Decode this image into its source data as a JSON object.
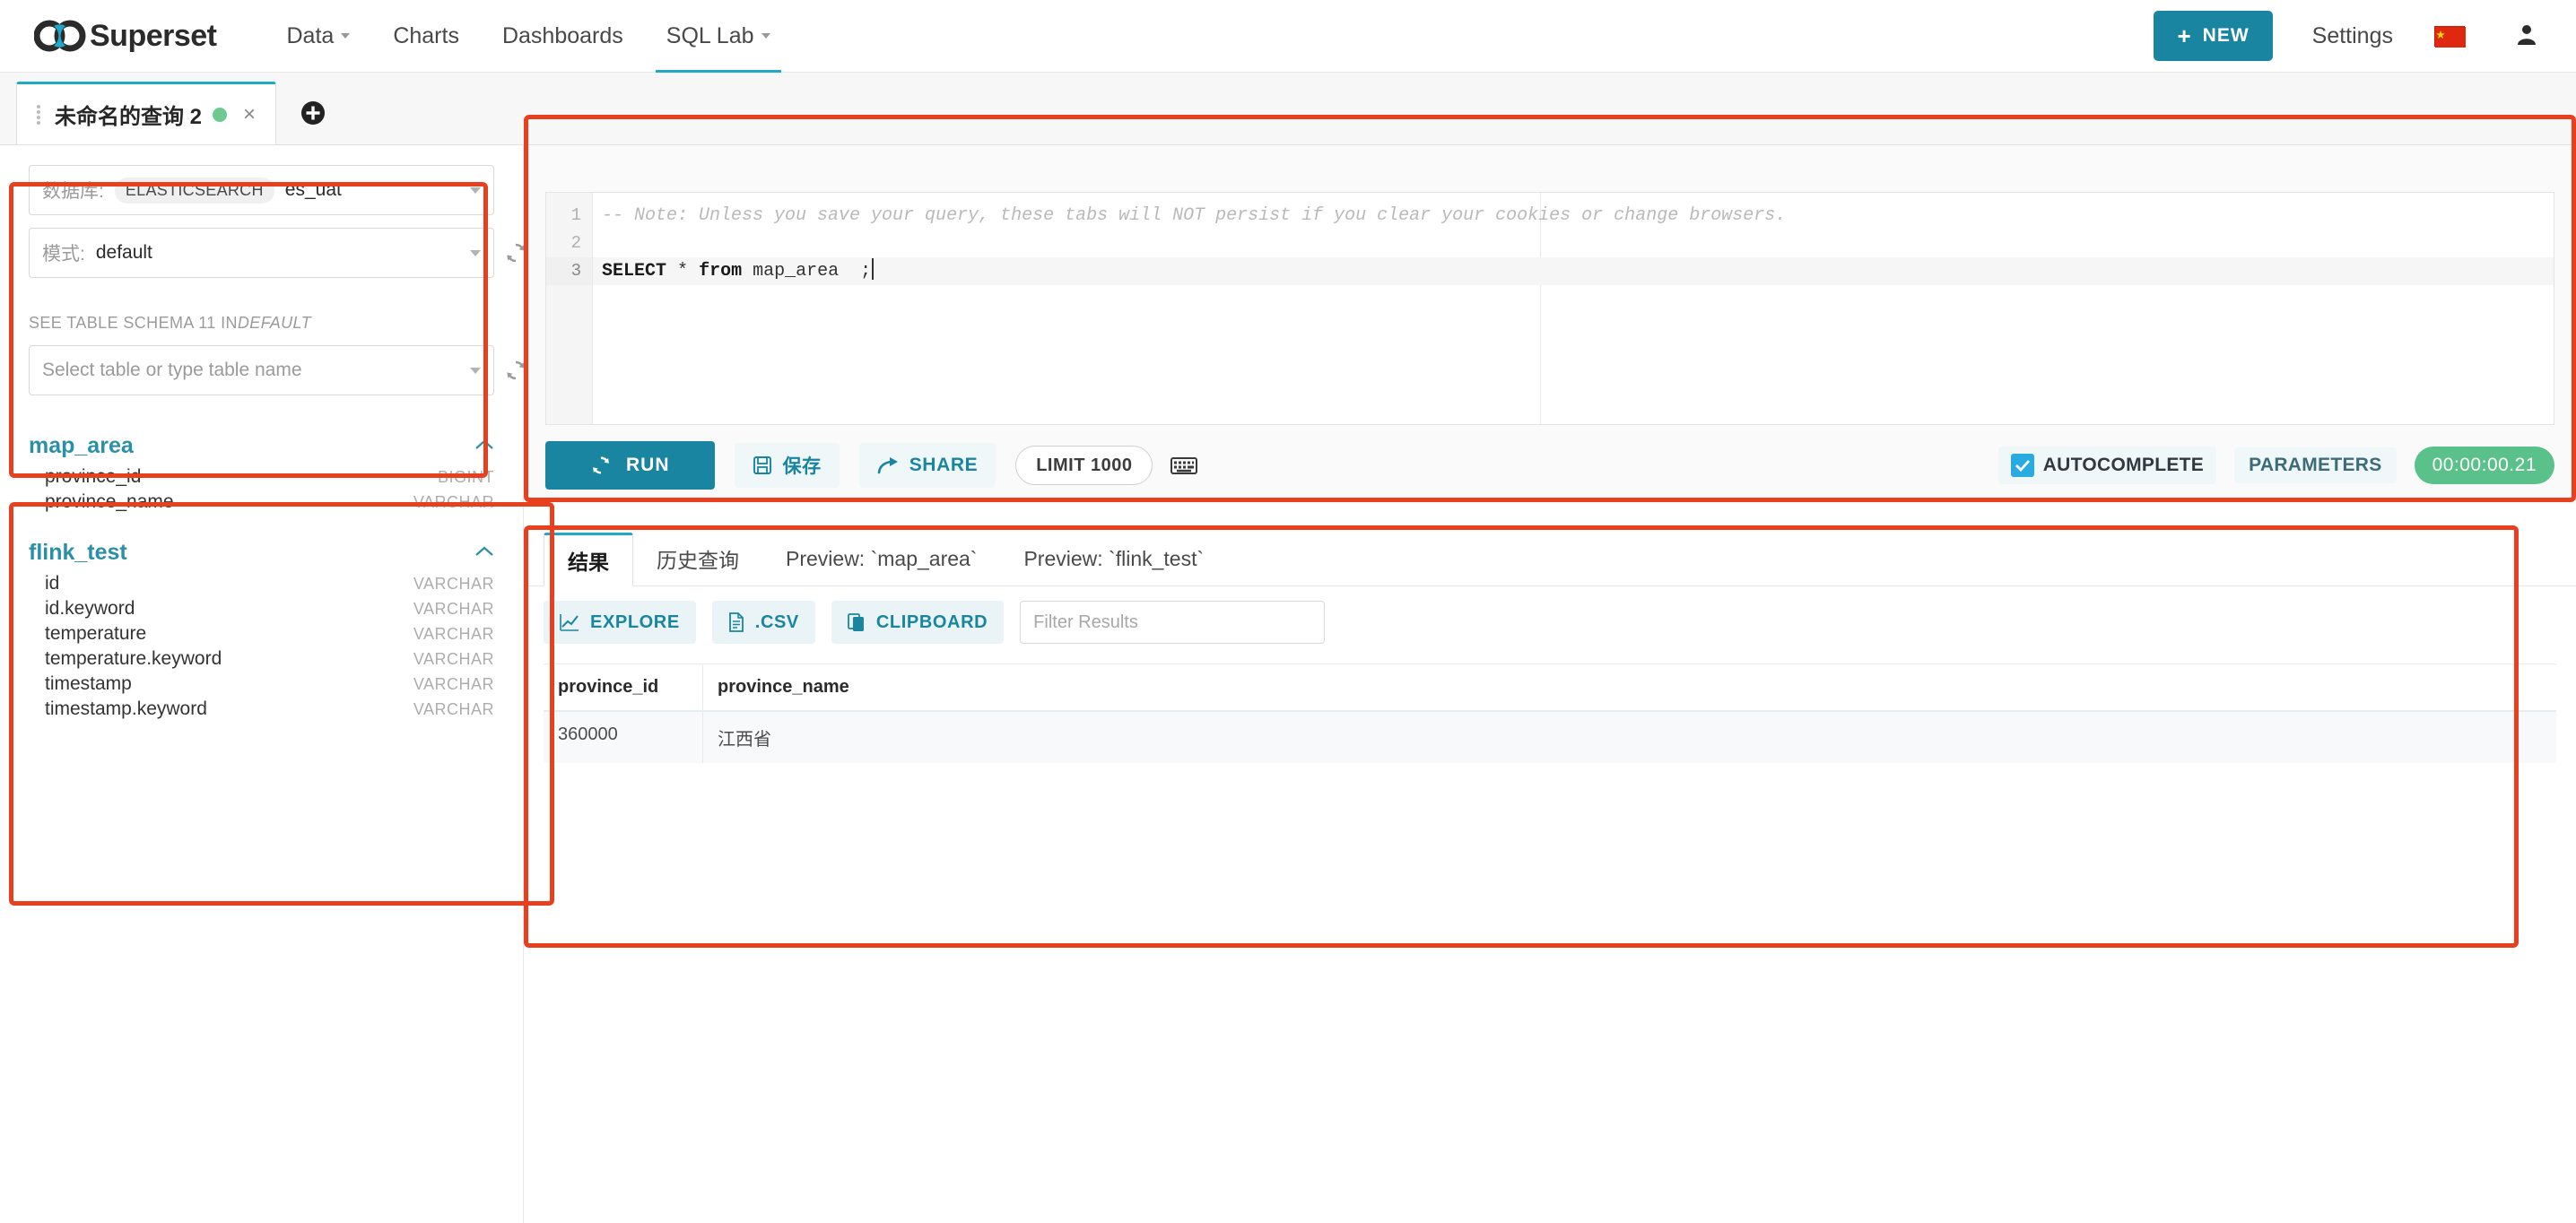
{
  "navbar": {
    "brand": "Superset",
    "brand_logo_icon": "infinity-logo-icon",
    "links": [
      {
        "label": "Data",
        "has_caret": true,
        "active": false
      },
      {
        "label": "Charts",
        "has_caret": false,
        "active": false
      },
      {
        "label": "Dashboards",
        "has_caret": false,
        "active": false
      },
      {
        "label": "SQL Lab",
        "has_caret": true,
        "active": true
      }
    ],
    "new_button": {
      "label": "NEW",
      "plus": "+",
      "color": "#1a85a0"
    },
    "settings": {
      "label": "Settings"
    },
    "language_flag": {
      "name": "china-flag-icon",
      "color": "#de2910"
    },
    "user_icon": "user-avatar-icon"
  },
  "tabbar": {
    "tab": {
      "title": "未命名的查询 2",
      "status_color": "#6cca8f",
      "close_label": "×"
    },
    "add_tab_icon": "plus-circle-icon"
  },
  "left_panel": {
    "database": {
      "label": "数据库:",
      "engine_pill": "ELASTICSEARCH",
      "value": "es_uat"
    },
    "schema": {
      "label": "模式:",
      "value": "default"
    },
    "schema_note_prefix": "SEE TABLE SCHEMA 11 IN",
    "schema_note_emphasis": "DEFAULT",
    "table_select_placeholder": "Select table or type table name",
    "tables": [
      {
        "name": "map_area",
        "expanded": true,
        "columns": [
          {
            "name": "province_id",
            "type": "BIGINT"
          },
          {
            "name": "province_name",
            "type": "VARCHAR"
          }
        ]
      },
      {
        "name": "flink_test",
        "expanded": true,
        "columns": [
          {
            "name": "id",
            "type": "VARCHAR"
          },
          {
            "name": "id.keyword",
            "type": "VARCHAR"
          },
          {
            "name": "temperature",
            "type": "VARCHAR"
          },
          {
            "name": "temperature.keyword",
            "type": "VARCHAR"
          },
          {
            "name": "timestamp",
            "type": "VARCHAR"
          },
          {
            "name": "timestamp.keyword",
            "type": "VARCHAR"
          }
        ]
      }
    ]
  },
  "editor": {
    "lines": [
      {
        "number": "1",
        "current": false,
        "text": "-- Note: Unless you save your query, these tabs will NOT persist if you clear your cookies or change browsers."
      },
      {
        "number": "2",
        "current": false,
        "text": ""
      },
      {
        "number": "3",
        "current": true,
        "text": "SELECT * from map_area  ;"
      }
    ],
    "line1_comment": "-- Note: Unless you save your query, these tabs will NOT persist if you clear your cookies or change browsers.",
    "line3_kw1": "SELECT",
    "line3_star": "*",
    "line3_kw2": "from",
    "line3_table": "map_area",
    "line3_semi": ";"
  },
  "toolbar": {
    "run_label": "RUN",
    "run_icon": "refresh-icon",
    "save_label": "保存",
    "save_icon": "save-disk-icon",
    "share_label": "SHARE",
    "share_icon": "share-arrow-icon",
    "limit_label": "LIMIT 1000",
    "keyboard_icon": "keyboard-icon",
    "autocomplete_label": "AUTOCOMPLETE",
    "autocomplete_checked": true,
    "parameters_label": "PARAMETERS",
    "timer": "00:00:00.21",
    "timer_color": "#59c189"
  },
  "results": {
    "tabs": [
      {
        "label": "结果",
        "active": true
      },
      {
        "label": "历史查询",
        "active": false
      },
      {
        "label": "Preview: `map_area`",
        "active": false
      },
      {
        "label": "Preview: `flink_test`",
        "active": false
      }
    ],
    "actions": [
      {
        "label": "EXPLORE",
        "icon": "chart-line-icon"
      },
      {
        "label": ".CSV",
        "icon": "file-icon"
      },
      {
        "label": "CLIPBOARD",
        "icon": "clipboard-icon"
      }
    ],
    "filter_placeholder": "Filter Results",
    "filter_value": "",
    "table": {
      "columns": [
        "province_id",
        "province_name"
      ],
      "rows": [
        [
          "360000",
          "江西省"
        ]
      ]
    }
  },
  "annotations": {
    "color": "#e8401f",
    "boxes": [
      "database-selectors",
      "schema-tree",
      "sql-editor",
      "results-area"
    ]
  }
}
